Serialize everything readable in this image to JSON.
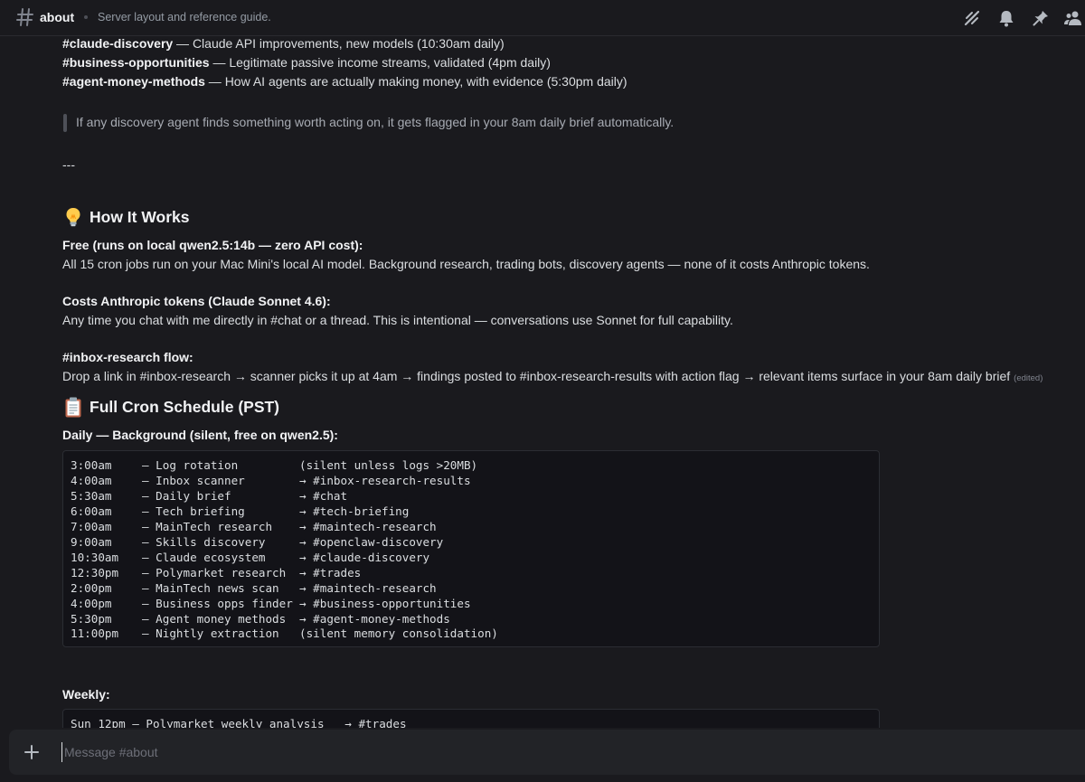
{
  "header": {
    "channel": "about",
    "topic": "Server layout and reference guide."
  },
  "channels_list": [
    {
      "name": "#claude-discovery",
      "desc": " — Claude API improvements, new models (10:30am daily)"
    },
    {
      "name": "#business-opportunities",
      "desc": " — Legitimate passive income streams, validated (4pm daily)"
    },
    {
      "name": "#agent-money-methods",
      "desc": " — How AI agents are actually making money, with evidence (5:30pm daily)"
    }
  ],
  "quote": "If any discovery agent finds something worth acting on, it gets flagged in your 8am daily brief automatically.",
  "divider": "---",
  "how_it_works": {
    "heading": "How It Works",
    "free_title": "Free (runs on local qwen2.5:14b — zero API cost):",
    "free_text": "All 15 cron jobs run on your Mac Mini's local AI model. Background research, trading bots, discovery agents — none of it costs Anthropic tokens.",
    "costs_title": "Costs Anthropic tokens (Claude Sonnet 4.6):",
    "costs_text": "Any time you chat with me directly in #chat or a thread. This is intentional — conversations use Sonnet for full capability.",
    "inbox_title": "#inbox-research flow:",
    "inbox_text": "Drop a link in #inbox-research → scanner picks it up at 4am → findings posted to #inbox-research-results with action flag → relevant items surface in your 8am daily brief",
    "edited": "(edited)"
  },
  "schedule": {
    "heading": "Full Cron Schedule (PST)",
    "daily_title": "Daily — Background (silent, free on qwen2.5):",
    "daily": [
      {
        "time": "3:00am",
        "task": "— Log rotation",
        "target": "(silent unless logs >20MB)"
      },
      {
        "time": "4:00am",
        "task": "— Inbox scanner",
        "target": "→ #inbox-research-results"
      },
      {
        "time": "5:30am",
        "task": "— Daily brief",
        "target": "→ #chat"
      },
      {
        "time": "6:00am",
        "task": "— Tech briefing",
        "target": "→ #tech-briefing"
      },
      {
        "time": "7:00am",
        "task": "— MainTech research",
        "target": "→ #maintech-research"
      },
      {
        "time": "9:00am",
        "task": "— Skills discovery",
        "target": "→ #openclaw-discovery"
      },
      {
        "time": "10:30am",
        "task": "— Claude ecosystem",
        "target": "→ #claude-discovery"
      },
      {
        "time": "12:30pm",
        "task": "— Polymarket research",
        "target": "→ #trades"
      },
      {
        "time": "2:00pm",
        "task": "— MainTech news scan",
        "target": "→ #maintech-research"
      },
      {
        "time": "4:00pm",
        "task": "— Business opps finder",
        "target": "→ #business-opportunities"
      },
      {
        "time": "5:30pm",
        "task": "— Agent money methods",
        "target": "→ #agent-money-methods"
      },
      {
        "time": "11:00pm",
        "task": "— Nightly extraction",
        "target": "(silent memory consolidation)"
      }
    ],
    "weekly_title": "Weekly:",
    "weekly_line": "Sun 12pm — Polymarket weekly analysis   → #trades"
  },
  "composer": {
    "placeholder": "Message #about"
  },
  "icons": {
    "hash": "hash-icon",
    "threads": "threads-icon",
    "bell": "bell-icon",
    "pin": "pin-icon",
    "members": "members-icon",
    "plus": "plus-icon",
    "bulb": "lightbulb-emoji",
    "clipboard": "clipboard-emoji"
  },
  "colors": {
    "background": "#1a1a1e",
    "codeblock": "#131318",
    "composer": "#222327",
    "text": "#dbdee1",
    "muted": "#949ba4"
  }
}
